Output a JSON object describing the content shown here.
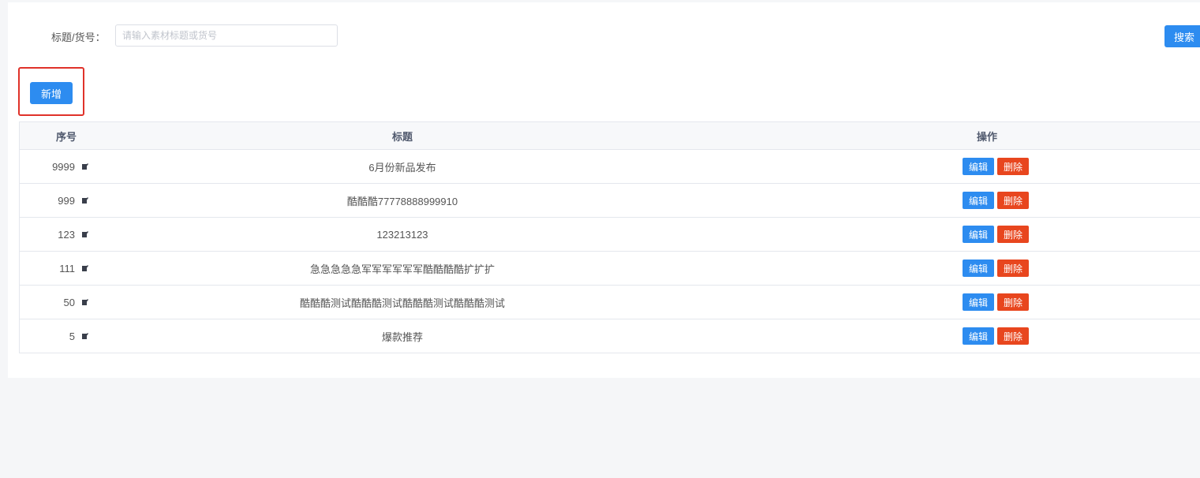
{
  "search": {
    "label": "标题/货号：",
    "placeholder": "请输入素材标题或货号",
    "value": "",
    "button_label": "搜索"
  },
  "toolbar": {
    "add_label": "新增"
  },
  "table": {
    "headers": {
      "seq": "序号",
      "title": "标题",
      "action": "操作"
    },
    "rows": [
      {
        "seq": "9999",
        "title": "6月份新品发布",
        "edit": "编辑",
        "delete": "删除"
      },
      {
        "seq": "999",
        "title": "酷酷酷77778888999910",
        "edit": "编辑",
        "delete": "删除"
      },
      {
        "seq": "123",
        "title": "123213123",
        "edit": "编辑",
        "delete": "删除"
      },
      {
        "seq": "111",
        "title": "急急急急急军军军军军军酷酷酷酷扩扩扩",
        "edit": "编辑",
        "delete": "删除"
      },
      {
        "seq": "50",
        "title": "酷酷酷测试酷酷酷测试酷酷酷测试酷酷酷测试",
        "edit": "编辑",
        "delete": "删除"
      },
      {
        "seq": "5",
        "title": "爆款推荐",
        "edit": "编辑",
        "delete": "删除"
      }
    ]
  },
  "icons": {
    "seq_edit": "pencil-edit-icon"
  },
  "colors": {
    "primary": "#2d8cf0",
    "danger": "#e8461e",
    "highlight": "#e0322a"
  }
}
